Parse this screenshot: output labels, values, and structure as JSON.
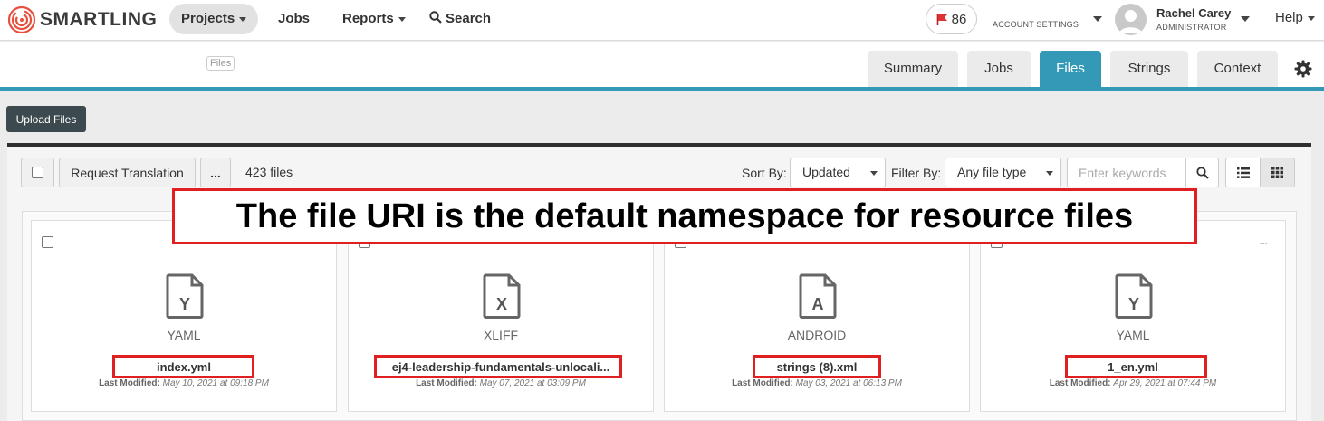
{
  "brand": {
    "name": "SMARTLING"
  },
  "nav": {
    "projects": "Projects",
    "jobs": "Jobs",
    "reports": "Reports",
    "search": "Search",
    "notification_count": "86",
    "account_settings": "ACCOUNT SETTINGS",
    "user_name": "Rachel Carey",
    "user_role": "ADMINISTRATOR",
    "help": "Help"
  },
  "subheader": {
    "files_badge": "Files",
    "tabs": [
      {
        "label": "Summary"
      },
      {
        "label": "Jobs"
      },
      {
        "label": "Files",
        "active": true
      },
      {
        "label": "Strings"
      },
      {
        "label": "Context"
      }
    ]
  },
  "toolbar": {
    "upload_label": "Upload Files",
    "request_translation": "Request Translation",
    "more_label": "...",
    "file_count": "423 files",
    "sort_label": "Sort By:",
    "sort_value": "Updated",
    "filter_label": "Filter By:",
    "filter_value": "Any file type",
    "search_placeholder": "Enter keywords"
  },
  "annotation": {
    "text": "The file URI is the default namespace for resource files"
  },
  "files": [
    {
      "type_letter": "Y",
      "type": "YAML",
      "name": "index.yml",
      "modified_label": "Last Modified:",
      "modified": "May 10, 2021 at 09:18 PM"
    },
    {
      "type_letter": "X",
      "type": "XLIFF",
      "name": "ej4-leadership-fundamentals-unlocali...",
      "modified_label": "Last Modified:",
      "modified": "May 07, 2021 at 03:09 PM"
    },
    {
      "type_letter": "A",
      "type": "ANDROID",
      "name": "strings (8).xml",
      "modified_label": "Last Modified:",
      "modified": "May 03, 2021 at 06:13 PM"
    },
    {
      "type_letter": "Y",
      "type": "YAML",
      "name": "1_en.yml",
      "modified_label": "Last Modified:",
      "modified": "Apr 29, 2021 at 07:44 PM"
    }
  ],
  "colors": {
    "accent": "#3399b7",
    "highlight": "#e02020",
    "dark_button": "#3c4a4f"
  }
}
